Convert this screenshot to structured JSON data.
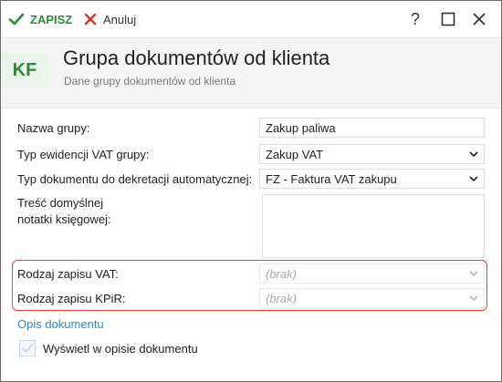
{
  "toolbar": {
    "save_label": "ZAPISZ",
    "cancel_label": "Anuluj",
    "help_label": "?"
  },
  "header": {
    "badge": "KF",
    "title": "Grupa dokumentów od klienta",
    "subtitle": "Dane grupy dokumentów od klienta"
  },
  "form": {
    "group_name": {
      "label": "Nazwa grupy:",
      "value": "Zakup paliwa"
    },
    "vat_record_type": {
      "label": "Typ ewidencji VAT grupy:",
      "value": "Zakup VAT"
    },
    "document_type": {
      "label": "Typ dokumentu do dekretacji automatycznej:",
      "value": "FZ - Faktura VAT zakupu"
    },
    "note": {
      "label_line1": "Treść domyślnej",
      "label_line2": "notatki księgowej:",
      "value": ""
    },
    "vat_entry_type": {
      "label": "Rodzaj zapisu VAT:",
      "value": "(brak)"
    },
    "kpir_entry_type": {
      "label": "Rodzaj zapisu KPiR:",
      "value": "(brak)"
    }
  },
  "description": {
    "link_label": "Opis dokumentu",
    "checkbox_label": "Wyświetl w opisie dokumentu",
    "checked": false
  },
  "colors": {
    "accent_green": "#2e8b35",
    "highlight_red": "#e5463f",
    "link_blue": "#2f88c8"
  }
}
